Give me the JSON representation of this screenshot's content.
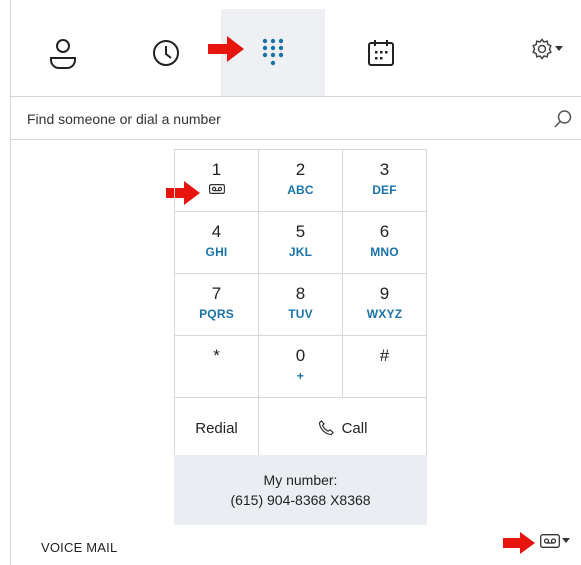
{
  "search": {
    "placeholder": "Find someone or dial a number"
  },
  "tabs": [
    {
      "name": "contacts",
      "icon": "person-icon"
    },
    {
      "name": "recent",
      "icon": "clock-icon"
    },
    {
      "name": "dialpad",
      "icon": "dialpad-icon",
      "active": true
    },
    {
      "name": "meetings",
      "icon": "calendar-icon"
    }
  ],
  "keypad": {
    "keys": [
      {
        "digit": "1",
        "letters": "",
        "icon": "voicemail-icon"
      },
      {
        "digit": "2",
        "letters": "ABC"
      },
      {
        "digit": "3",
        "letters": "DEF"
      },
      {
        "digit": "4",
        "letters": "GHI"
      },
      {
        "digit": "5",
        "letters": "JKL"
      },
      {
        "digit": "6",
        "letters": "MNO"
      },
      {
        "digit": "7",
        "letters": "PQRS"
      },
      {
        "digit": "8",
        "letters": "TUV"
      },
      {
        "digit": "9",
        "letters": "WXYZ"
      },
      {
        "digit": "*",
        "letters": ""
      },
      {
        "digit": "0",
        "letters": "+"
      },
      {
        "digit": "#",
        "letters": ""
      }
    ],
    "redial_label": "Redial",
    "call_label": "Call"
  },
  "my_number": {
    "label": "My number:",
    "value": "(615) 904-8368 X8368"
  },
  "footer": {
    "voicemail_label": "VOICE MAIL"
  },
  "colors": {
    "accent": "#1a73a8",
    "active_tab_bg": "#eef0f3",
    "annotation_arrow": "#e8150f"
  }
}
